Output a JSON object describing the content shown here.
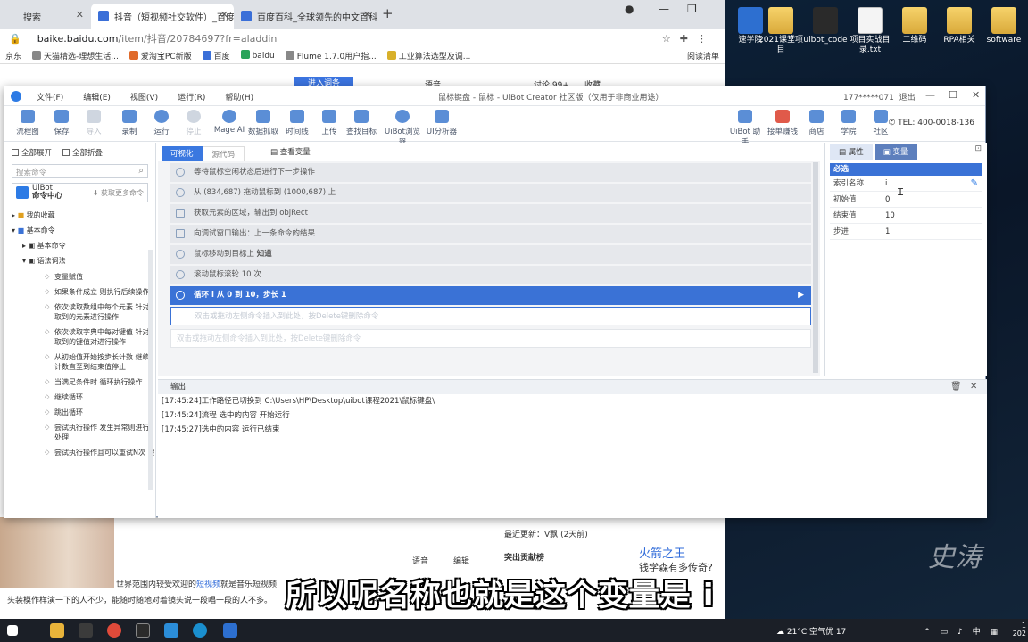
{
  "browser": {
    "tabs": [
      {
        "label": "搜索"
      },
      {
        "label": "抖音（短视频社交软件）_百度百"
      },
      {
        "label": "百度百科_全球领先的中文百科全"
      }
    ],
    "url_host": "baike.baidu.com",
    "url_path": "/item/抖音/20784697?fr=aladdin",
    "bookmarks": [
      "京东",
      "天猫精选-理想生活...",
      "爱淘宝PC新版",
      "百度",
      "baidu",
      "Flume 1.7.0用户指...",
      "工业算法选型及调..."
    ],
    "reading_list": "阅读清单"
  },
  "webpage": {
    "search_btn": "进入词条",
    "voice": "语音",
    "discuss": "讨论 99+",
    "favorite": "收藏",
    "voice2": "语音",
    "edit": "编辑",
    "body_text_1": "世界范围内较受欢迎的",
    "body_link": "短视频",
    "body_text_2": "就是音乐短视频",
    "body_text_3": "头装模作样演一下的人不少，能随时随地对着镜头说一段唱一段的人不多。",
    "recent_update": "最近更新：",
    "recent_user": "V飘",
    "recent_time": "(2天前)",
    "contrib": "突出贡献榜",
    "sidebar_title": "火箭之王",
    "sidebar_sub": "钱学森有多传奇?"
  },
  "uibot": {
    "menu": [
      "文件(F)",
      "编辑(E)",
      "视图(V)",
      "运行(R)",
      "帮助(H)"
    ],
    "title": "鼠标键盘 - 鼠标 - UiBot Creator 社区版（仅用于非商业用途）",
    "user": "177*****071",
    "logout": "退出",
    "toolbar": [
      "流程图",
      "保存",
      "导入",
      "录制",
      "运行",
      "停止",
      "Mage AI",
      "数据抓取",
      "时间线",
      "上传",
      "查找目标",
      "UiBot浏览器",
      "UI分析器"
    ],
    "toolbar_right": [
      "UiBot 助手",
      "接单赚钱",
      "商店",
      "学院",
      "社区"
    ],
    "tel": "TEL: 400-0018-136",
    "left": {
      "expand_all": "全部展开",
      "collapse_all": "全部折叠",
      "search_placeholder": "搜索命令",
      "center_name_1": "UiBot",
      "center_name_2": "命令中心",
      "fetch_more": "获取更多命令",
      "my_favorites": "我的收藏",
      "basic_commands": "基本命令",
      "basic_commands_sub": "基本命令",
      "syntax": "语法词法",
      "leaves": [
        "变量赋值",
        "如果条件成立 则执行后续操作",
        "依次读取数组中每个元素 针对取到的元素进行操作",
        "依次读取字典中每对键值 针对取到的键值对进行操作",
        "从初始值开始按步长计数 继续计数直至到结束值停止",
        "当满足条件时 循环执行操作",
        "继续循环",
        "跳出循环",
        "尝试执行操作 发生异常则进行处理",
        "尝试执行操作且可以重试N次 尝试后仍发生异常则进行处理"
      ]
    },
    "editor": {
      "tab_visual": "可视化",
      "tab_source": "源代码",
      "view_vars": "查看变量",
      "rows": [
        "等待鼠标空闲状态后进行下一步操作",
        "从 (834,687) 拖动鼠标到 (1000,687) 上",
        "获取元素的区域，输出到 objRect",
        "向调试窗口输出：上一条命令的结果",
        "鼠标移动到目标上",
        "滚动鼠标滚轮 10 次"
      ],
      "row5_suffix": "知道",
      "loop_row": "循环 i 从 0 到 10，步长 1",
      "drop_hint": "双击或拖动左侧命令插入到此处，按Delete键删除命令"
    },
    "props": {
      "tab_props": "属性",
      "tab_vars": "变量",
      "section": "必选",
      "rows": [
        {
          "key": "索引名称",
          "value": "i"
        },
        {
          "key": "初始值",
          "value": "0"
        },
        {
          "key": "结束值",
          "value": "10"
        },
        {
          "key": "步进",
          "value": "1"
        }
      ]
    },
    "output": {
      "title": "输出",
      "lines": [
        "[17:45:24]工作路径已切换到 C:\\Users\\HP\\Desktop\\uibot课程2021\\鼠标键盘\\",
        "[17:45:24]流程 选中的内容 开始运行",
        "[17:45:27]选中的内容 运行已结束"
      ]
    }
  },
  "desktop": {
    "icons": [
      "速学院",
      "2021课堂项目",
      "uibot_code",
      "项目实战目录.txt",
      "二维码",
      "RPA相关",
      "software"
    ],
    "watermark": "史涛"
  },
  "taskbar": {
    "weather": "21°C 空气优 17",
    "time_line1": "1",
    "time_line2": "202",
    "ime": "中"
  },
  "subtitle": "所以呢名称也就是这个变量是 i"
}
